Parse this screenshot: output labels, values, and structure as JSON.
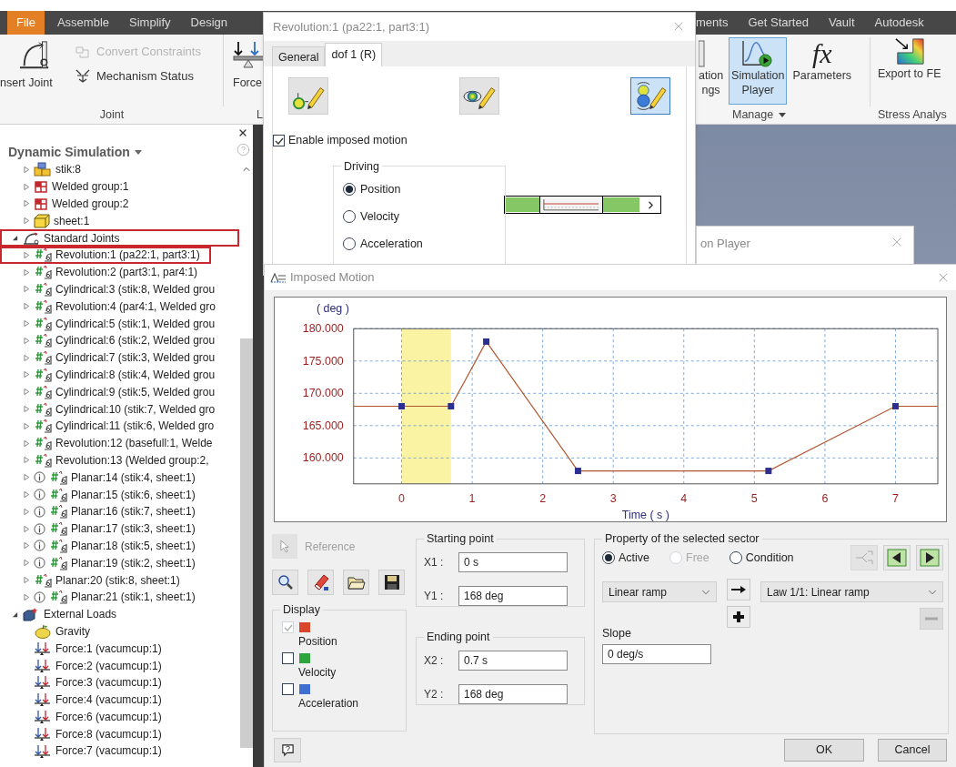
{
  "ribbon": {
    "tabs": [
      {
        "label": "File",
        "kind": "menu"
      },
      {
        "label": "Assemble",
        "kind": "tab"
      },
      {
        "label": "Simplify",
        "kind": "tab"
      },
      {
        "label": "Design",
        "kind": "tab"
      }
    ],
    "more_tabs": [
      {
        "label": "ments",
        "kind": "tab"
      },
      {
        "label": "Get Started",
        "kind": "tab"
      },
      {
        "label": "Vault",
        "kind": "tab"
      },
      {
        "label": "Autodesk",
        "kind": "tab"
      }
    ],
    "joint_group": {
      "label": "Joint",
      "insert_button": "nsert Joint",
      "commands": [
        {
          "label": "Convert Constraints",
          "disabled": true
        },
        {
          "label": "Mechanism Status",
          "disabled": false
        }
      ]
    },
    "loads_group": {
      "label": "L",
      "button": "Force"
    },
    "manage_group": {
      "label": "Manage",
      "buttons": [
        {
          "lines": [
            "ation",
            "ngs"
          ],
          "kind": "settings",
          "selected": false
        },
        {
          "lines": [
            "Simulation",
            "Player"
          ],
          "kind": "player",
          "selected": true
        },
        {
          "lines": [
            "Parameters"
          ],
          "kind": "parameters",
          "glyph": "fx",
          "selected": false
        }
      ]
    },
    "stress_group": {
      "label": "Stress Analys",
      "button": "Export to FE"
    }
  },
  "browser": {
    "title": "Dynamic Simulation",
    "continued_items": [
      {
        "label": "stik:8",
        "kind": "part",
        "expanded": false
      },
      {
        "label": "Welded group:1",
        "kind": "weld",
        "expanded": false
      },
      {
        "label": "Welded group:2",
        "kind": "weld",
        "expanded": false
      },
      {
        "label": "sheet:1",
        "kind": "sheet",
        "expanded": false
      }
    ],
    "items": [
      {
        "label": "Standard Joints",
        "kind": "joints",
        "expanded": true,
        "outlined": true,
        "children": [
          {
            "label": "Revolution:1 (pa22:1, part3:1)",
            "kind": "joint",
            "expanded": false,
            "outlined": true,
            "info": false
          },
          {
            "label": "Revolution:2 (part3:1, par4:1)",
            "kind": "joint",
            "expanded": false,
            "outlined": false,
            "info": false
          },
          {
            "label": "Cylindrical:3 (stik:8, Welded grou",
            "kind": "joint",
            "expanded": false,
            "outlined": false,
            "info": false
          },
          {
            "label": "Revolution:4 (par4:1, Welded gro",
            "kind": "joint",
            "expanded": false,
            "outlined": false,
            "info": false
          },
          {
            "label": "Cylindrical:5 (stik:1, Welded grou",
            "kind": "joint",
            "expanded": false,
            "outlined": false,
            "info": false
          },
          {
            "label": "Cylindrical:6 (stik:2, Welded grou",
            "kind": "joint",
            "expanded": false,
            "outlined": false,
            "info": false
          },
          {
            "label": "Cylindrical:7 (stik:3, Welded grou",
            "kind": "joint",
            "expanded": false,
            "outlined": false,
            "info": false
          },
          {
            "label": "Cylindrical:8 (stik:4, Welded grou",
            "kind": "joint",
            "expanded": false,
            "outlined": false,
            "info": false
          },
          {
            "label": "Cylindrical:9 (stik:5, Welded grou",
            "kind": "joint",
            "expanded": false,
            "outlined": false,
            "info": false
          },
          {
            "label": "Cylindrical:10 (stik:7, Welded gro",
            "kind": "joint",
            "expanded": false,
            "outlined": false,
            "info": false
          },
          {
            "label": "Cylindrical:11 (stik:6, Welded gro",
            "kind": "joint",
            "expanded": false,
            "outlined": false,
            "info": false
          },
          {
            "label": "Revolution:12 (basefull:1, Welde",
            "kind": "joint",
            "expanded": false,
            "outlined": false,
            "info": false
          },
          {
            "label": "Revolution:13 (Welded group:2,",
            "kind": "joint",
            "expanded": false,
            "outlined": false,
            "info": false
          },
          {
            "label": "Planar:14 (stik:4, sheet:1)",
            "kind": "joint",
            "expanded": false,
            "outlined": false,
            "info": true
          },
          {
            "label": "Planar:15 (stik:6, sheet:1)",
            "kind": "joint",
            "expanded": false,
            "outlined": false,
            "info": true
          },
          {
            "label": "Planar:16 (stik:7, sheet:1)",
            "kind": "joint",
            "expanded": false,
            "outlined": false,
            "info": true
          },
          {
            "label": "Planar:17 (stik:3, sheet:1)",
            "kind": "joint",
            "expanded": false,
            "outlined": false,
            "info": true
          },
          {
            "label": "Planar:18 (stik:5, sheet:1)",
            "kind": "joint",
            "expanded": false,
            "outlined": false,
            "info": true
          },
          {
            "label": "Planar:19 (stik:2, sheet:1)",
            "kind": "joint",
            "expanded": false,
            "outlined": false,
            "info": true
          },
          {
            "label": "Planar:20 (stik:8, sheet:1)",
            "kind": "joint",
            "expanded": false,
            "outlined": false,
            "info": false
          },
          {
            "label": "Planar:21 (stik:1, sheet:1)",
            "kind": "joint",
            "expanded": false,
            "outlined": false,
            "info": true
          }
        ]
      },
      {
        "label": "External Loads",
        "kind": "loads",
        "expanded": true,
        "outlined": false,
        "children": [
          {
            "label": "Gravity",
            "kind": "gravity"
          },
          {
            "label": "Force:1 (vacumcup:1)",
            "kind": "force"
          },
          {
            "label": "Force:2 (vacumcup:1)",
            "kind": "force"
          },
          {
            "label": "Force:3 (vacumcup:1)",
            "kind": "force"
          },
          {
            "label": "Force:4 (vacumcup:1)",
            "kind": "force"
          },
          {
            "label": "Force:6 (vacumcup:1)",
            "kind": "force"
          },
          {
            "label": "Force:8 (vacumcup:1)",
            "kind": "force"
          },
          {
            "label": "Force:7 (vacumcup:1)",
            "kind": "force"
          }
        ]
      }
    ]
  },
  "joint_dialog": {
    "title": "Revolution:1 (pa22:1, part3:1)",
    "tabs": [
      {
        "label": "General",
        "selected": false
      },
      {
        "label": "dof 1 (R)",
        "selected": true
      }
    ],
    "tool_buttons": [
      {
        "kind": "dot",
        "selected": false
      },
      {
        "kind": "orbit",
        "selected": false
      },
      {
        "kind": "stack",
        "selected": true
      }
    ],
    "enable_imposed_motion": {
      "label": "Enable imposed motion",
      "checked": true
    },
    "driving": {
      "title": "Driving",
      "options": [
        {
          "label": "Position",
          "selected": true
        },
        {
          "label": "Velocity",
          "selected": false
        },
        {
          "label": "Acceleration",
          "selected": false
        }
      ]
    }
  },
  "player_window": {
    "title": "on Player"
  },
  "imposed_motion": {
    "title": "Imposed Motion",
    "chart_data": {
      "type": "line",
      "xlabel": "Time ( s )",
      "ylabel": "( deg )",
      "x": [
        -0.68,
        0,
        0.7,
        1.2,
        2.5,
        5.2,
        7,
        7.6
      ],
      "series": [
        {
          "color": "#b0562c",
          "marker": "square",
          "values": [
            168,
            168,
            168,
            178,
            158,
            158,
            168,
            168
          ]
        }
      ],
      "xlim": [
        -0.68,
        7.6
      ],
      "ylim": [
        156,
        180
      ],
      "xticks": [
        0,
        1,
        2,
        3,
        4,
        5,
        6,
        7
      ],
      "yticks": [
        {
          "value": 160,
          "label": "160.000"
        },
        {
          "value": 165,
          "label": "165.000"
        },
        {
          "value": 170,
          "label": "170.000"
        },
        {
          "value": 175,
          "label": "175.000"
        },
        {
          "value": 180,
          "label": "180.000"
        }
      ],
      "grid": true,
      "bands": [
        {
          "axis": "x",
          "from": 0,
          "to": 0.7,
          "color": "#fbf3a4"
        }
      ]
    },
    "reference": {
      "label": "Reference",
      "disabled": true
    },
    "display": {
      "title": "Display",
      "items": [
        {
          "label": "Position",
          "checked": true,
          "disabled": true,
          "color": "#d9452b"
        },
        {
          "label": "Velocity",
          "checked": false,
          "disabled": false,
          "color": "#2fa43c"
        },
        {
          "label": "Acceleration",
          "checked": false,
          "disabled": false,
          "color": "#3f6fd1"
        }
      ]
    },
    "starting_point": {
      "title": "Starting point",
      "fields": [
        {
          "label": "X1 :",
          "value": "0 s"
        },
        {
          "label": "Y1 :",
          "value": "168 deg"
        }
      ]
    },
    "ending_point": {
      "title": "Ending point",
      "fields": [
        {
          "label": "X2 :",
          "value": "0.7 s"
        },
        {
          "label": "Y2 :",
          "value": "168 deg"
        }
      ]
    },
    "sector": {
      "title": "Property of the selected sector",
      "modes": [
        {
          "label": "Active",
          "selected": true,
          "disabled": false
        },
        {
          "label": "Free",
          "selected": false,
          "disabled": true
        },
        {
          "label": "Condition",
          "selected": false,
          "disabled": false
        }
      ],
      "tools": [
        {
          "kind": "split",
          "disabled": true
        },
        {
          "kind": "previous",
          "disabled": false
        },
        {
          "kind": "next",
          "disabled": false
        }
      ],
      "law_type": "Linear ramp",
      "law": "Law 1/1: Linear ramp",
      "law_buttons": [
        {
          "kind": "apply",
          "disabled": false
        },
        {
          "kind": "add",
          "disabled": false
        },
        {
          "kind": "remove",
          "disabled": true
        }
      ],
      "slope_label": "Slope",
      "slope": "0 deg/s"
    },
    "buttons": [
      {
        "label": "OK"
      },
      {
        "label": "Cancel"
      }
    ]
  }
}
